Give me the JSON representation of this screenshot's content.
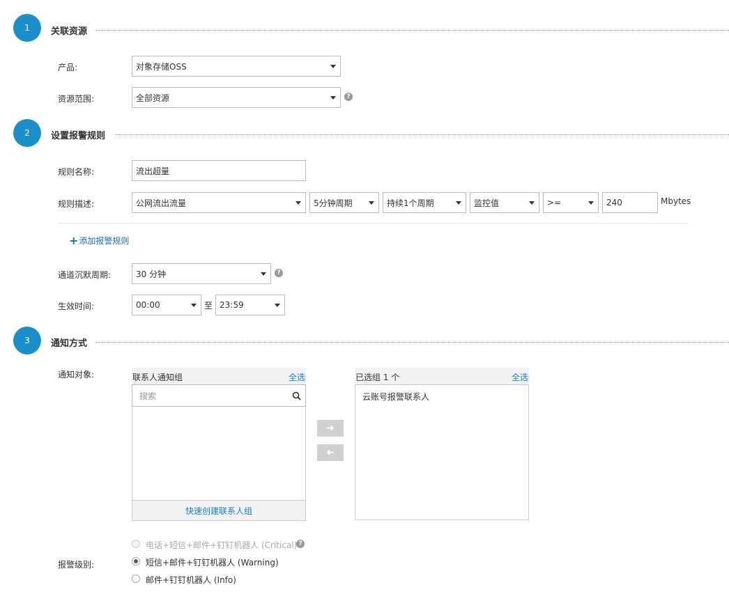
{
  "steps": [
    {
      "number": "1",
      "title": "关联资源"
    },
    {
      "number": "2",
      "title": "设置报警规则"
    },
    {
      "number": "3",
      "title": "通知方式"
    }
  ],
  "resource": {
    "product_label": "产品:",
    "product_value": "对象存储OSS",
    "scope_label": "资源范围:",
    "scope_value": "全部资源"
  },
  "rule": {
    "name_label": "规则名称:",
    "name_value": "流出超量",
    "desc_label": "规则描述:",
    "metric": "公网流出流量",
    "period": "5分钟周期",
    "duration": "持续1个周期",
    "stat": "监控值",
    "operator": ">=",
    "threshold": "240",
    "unit": "Mbytes",
    "add_rule": "添加报警规则",
    "silence_label": "通道沉默周期:",
    "silence_value": "30 分钟",
    "effective_label": "生效时间:",
    "start_time": "00:00",
    "to": "至",
    "end_time": "23:59"
  },
  "notify": {
    "target_label": "通知对象:",
    "left_panel_title": "联系人通知组",
    "select_all": "全选",
    "search_placeholder": "搜索",
    "create_group": "快速创建联系人组",
    "right_panel_title": "已选组 1 个",
    "selected_items": [
      "云账号报警联系人"
    ],
    "level_label": "报警级别:",
    "levels": [
      {
        "label": "电话+短信+邮件+钉钉机器人 (Critical)",
        "state": "disabled"
      },
      {
        "label": "短信+邮件+钉钉机器人 (Warning)",
        "state": "checked"
      },
      {
        "label": "邮件+钉钉机器人 (Info)",
        "state": "unchecked"
      }
    ]
  },
  "icons": [
    "help-icon",
    "search-icon",
    "arrow-right-icon",
    "arrow-left-icon",
    "plus-icon",
    "caret-down-icon"
  ],
  "colors": {
    "accent": "#1b8fc9",
    "link": "#1b6fb5",
    "button_gray": "#d0d0d0"
  }
}
